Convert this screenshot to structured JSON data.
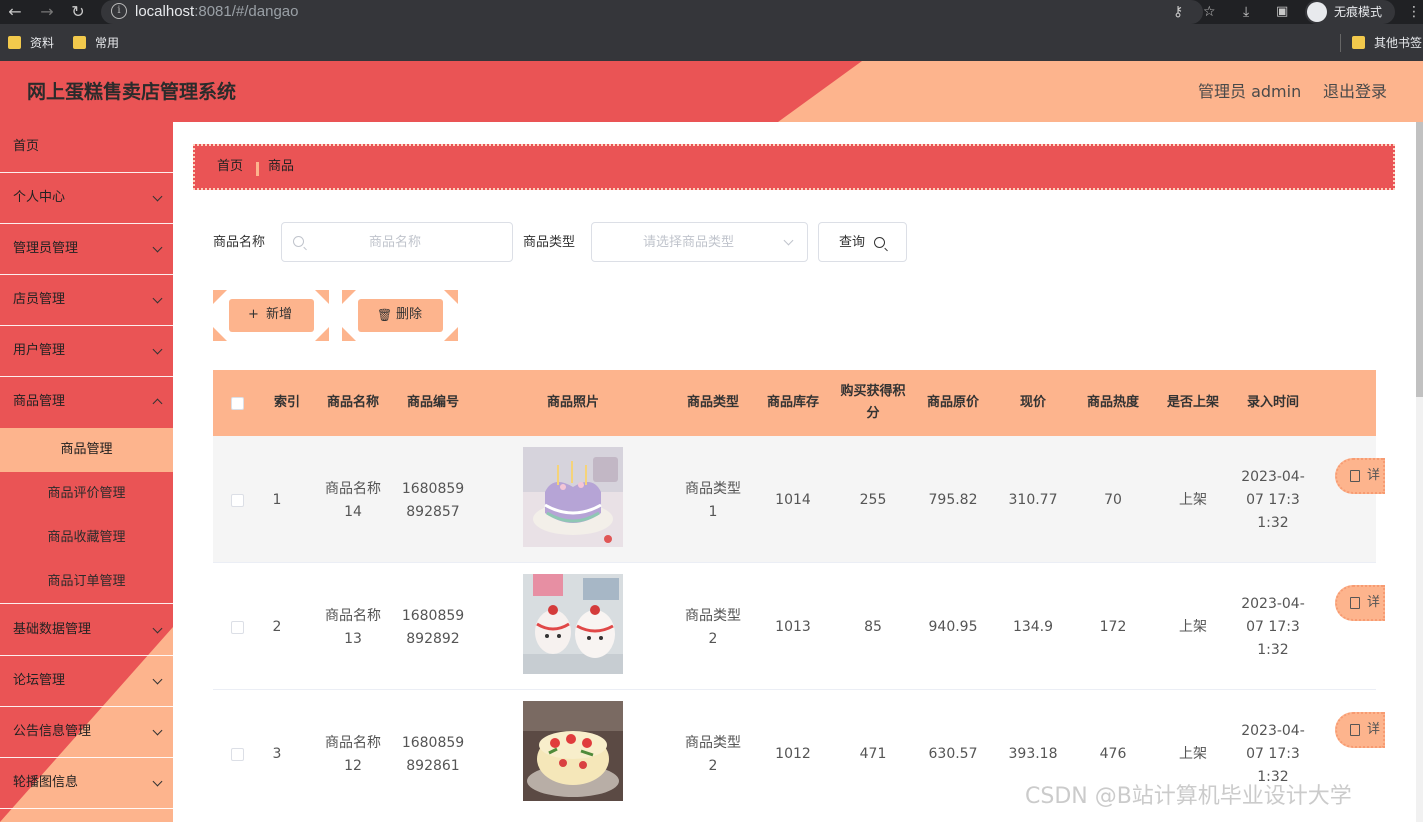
{
  "browser": {
    "url_host": "localhost",
    "url_rest": ":8081/#/dangao",
    "incognito_label": "无痕模式",
    "bookmarks": [
      "资料",
      "常用"
    ],
    "other_bookmarks": "其他书签"
  },
  "header": {
    "title": "网上蛋糕售卖店管理系统",
    "user_label": "管理员 admin",
    "logout_label": "退出登录"
  },
  "sidebar": {
    "items": [
      {
        "label": "首页"
      },
      {
        "label": "个人中心"
      },
      {
        "label": "管理员管理"
      },
      {
        "label": "店员管理"
      },
      {
        "label": "用户管理"
      },
      {
        "label": "商品管理"
      }
    ],
    "sub_items": [
      {
        "label": "商品管理"
      },
      {
        "label": "商品评价管理"
      },
      {
        "label": "商品收藏管理"
      },
      {
        "label": "商品订单管理"
      }
    ],
    "items_after": [
      {
        "label": "基础数据管理"
      },
      {
        "label": "论坛管理"
      },
      {
        "label": "公告信息管理"
      },
      {
        "label": "轮播图信息"
      }
    ]
  },
  "breadcrumb": {
    "home": "首页",
    "current": "商品"
  },
  "search": {
    "name_label": "商品名称",
    "name_placeholder": "商品名称",
    "type_label": "商品类型",
    "type_placeholder": "请选择商品类型",
    "query_label": "查询"
  },
  "actions": {
    "add_label": "新增",
    "delete_label": "删除"
  },
  "table": {
    "headers": [
      "索引",
      "商品名称",
      "商品编号",
      "商品照片",
      "商品类型",
      "商品库存",
      "购买获得积分",
      "商品原价",
      "现价",
      "商品热度",
      "是否上架",
      "录入时间"
    ],
    "detail_label": "详",
    "rows": [
      {
        "index": "1",
        "name": "商品名称14",
        "code": "1680859892857",
        "type": "商品类型1",
        "stock": "1014",
        "points": "255",
        "orig_price": "795.82",
        "price": "310.77",
        "heat": "70",
        "status": "上架",
        "time": "2023-04-07 17:31:32"
      },
      {
        "index": "2",
        "name": "商品名称13",
        "code": "1680859892892",
        "type": "商品类型2",
        "stock": "1013",
        "points": "85",
        "orig_price": "940.95",
        "price": "134.9",
        "heat": "172",
        "status": "上架",
        "time": "2023-04-07 17:31:32"
      },
      {
        "index": "3",
        "name": "商品名称12",
        "code": "1680859892861",
        "type": "商品类型2",
        "stock": "1012",
        "points": "471",
        "orig_price": "630.57",
        "price": "393.18",
        "heat": "476",
        "status": "上架",
        "time": "2023-04-07 17:31:32"
      }
    ]
  },
  "watermark": "CSDN @B站计算机毕业设计大学"
}
